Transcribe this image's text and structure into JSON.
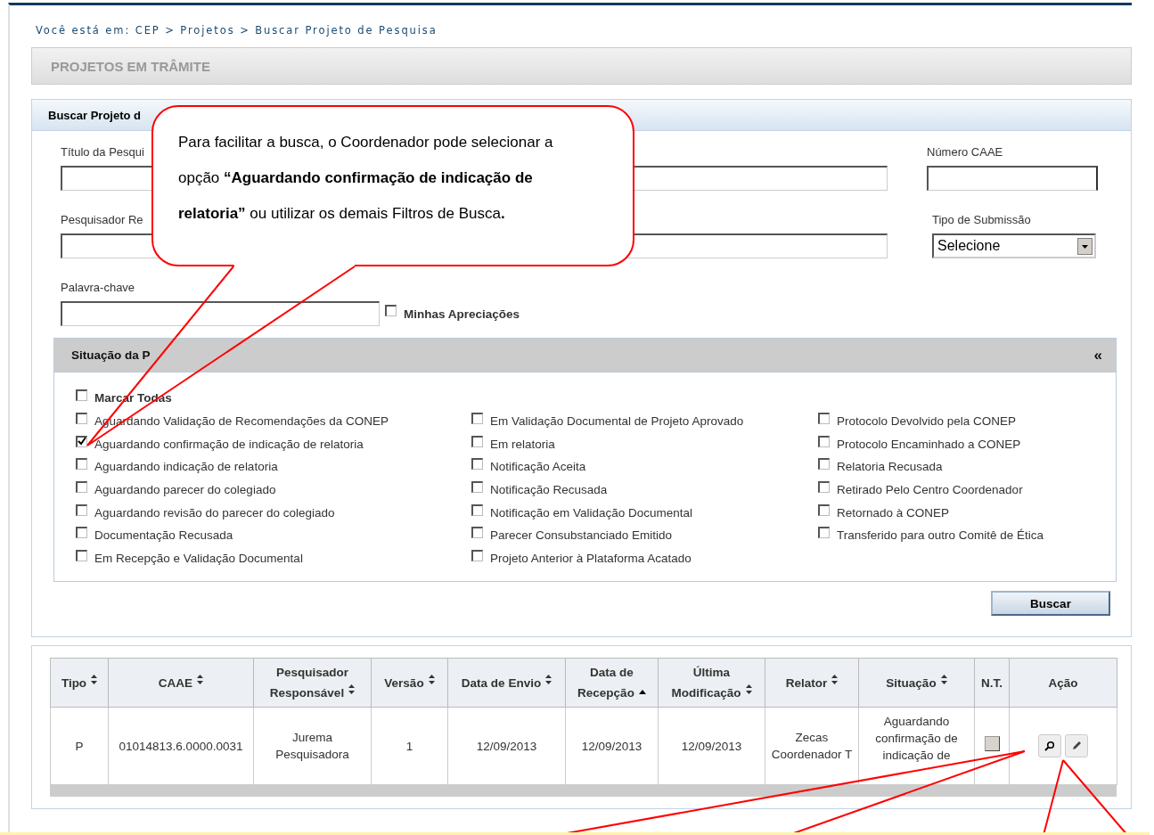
{
  "breadcrumb": "Você está em: CEP > Projetos > Buscar Projeto de Pesquisa",
  "page_title": "PROJETOS EM TRÂMITE",
  "search_panel": {
    "title": "Buscar Projeto d",
    "title_field": {
      "label": "Título da Pesqui"
    },
    "caae_field": {
      "label": "Número CAAE"
    },
    "researcher_field": {
      "label": "Pesquisador Re"
    },
    "submission_type_field": {
      "label": "Tipo de Submissão",
      "value": "Selecione"
    },
    "keyword_field": {
      "label": "Palavra-chave"
    },
    "my_reviews": {
      "label": "Minhas Apreciações",
      "checked": false
    },
    "status_filter": {
      "title": "Situação da P",
      "collapse_icon": "«",
      "select_all": {
        "label": "Marcar Todas",
        "checked": false
      },
      "columns": [
        {
          "options": [
            {
              "label": "Aguardando Validação de Recomendações da CONEP",
              "checked": false
            },
            {
              "label": "Aguardando confirmação de indicação de relatoria",
              "checked": true
            },
            {
              "label": "Aguardando indicação de relatoria",
              "checked": false
            },
            {
              "label": "Aguardando parecer do colegiado",
              "checked": false
            },
            {
              "label": "Aguardando revisão do parecer do colegiado",
              "checked": false
            },
            {
              "label": "Documentação Recusada",
              "checked": false
            },
            {
              "label": "Em Recepção e Validação Documental",
              "checked": false
            }
          ]
        },
        {
          "options": [
            {
              "label": "Em Validação Documental de Projeto Aprovado",
              "checked": false
            },
            {
              "label": "Em relatoria",
              "checked": false
            },
            {
              "label": "Notificação Aceita",
              "checked": false
            },
            {
              "label": "Notificação Recusada",
              "checked": false
            },
            {
              "label": "Notificação em Validação Documental",
              "checked": false
            },
            {
              "label": "Parecer Consubstanciado Emitido",
              "checked": false
            },
            {
              "label": "Projeto Anterior à Plataforma Acatado",
              "checked": false
            }
          ]
        },
        {
          "options": [
            {
              "label": "Protocolo Devolvido pela CONEP",
              "checked": false
            },
            {
              "label": "Protocolo Encaminhado a CONEP",
              "checked": false
            },
            {
              "label": "Relatoria Recusada",
              "checked": false
            },
            {
              "label": "Retirado Pelo Centro Coordenador",
              "checked": false
            },
            {
              "label": "Retornado à CONEP",
              "checked": false
            },
            {
              "label": "Transferido para outro Comitê de Ética",
              "checked": false
            }
          ]
        }
      ]
    },
    "search_button": "Buscar"
  },
  "table": {
    "columns": [
      {
        "label": "Tipo",
        "sortable": true,
        "sorted": false
      },
      {
        "label": "CAAE",
        "sortable": true,
        "sorted": false
      },
      {
        "label": "Pesquisador Responsável",
        "sortable": true,
        "sorted": false
      },
      {
        "label": "Versão",
        "sortable": true,
        "sorted": false
      },
      {
        "label": "Data de Envio",
        "sortable": true,
        "sorted": false
      },
      {
        "label": "Data de Recepção",
        "sortable": true,
        "sorted": true
      },
      {
        "label": "Última Modificação",
        "sortable": true,
        "sorted": false
      },
      {
        "label": "Relator",
        "sortable": true,
        "sorted": false
      },
      {
        "label": "Situação",
        "sortable": true,
        "sorted": false
      },
      {
        "label": "N.T.",
        "sortable": false,
        "sorted": false
      },
      {
        "label": "Ação",
        "sortable": false,
        "sorted": false
      }
    ],
    "rows": [
      {
        "cells": [
          "P",
          "01014813.6.0000.0031",
          "Jurema Pesquisadora",
          "1",
          "12/09/2013",
          "12/09/2013",
          "12/09/2013",
          "Zecas Coordenador T",
          "Aguardando confirmação de indicação de"
        ],
        "nt_checked": false
      }
    ]
  },
  "callout": {
    "text": "Para facilitar a busca, o Coordenador pode selecionar a opção **“Aguardando confirmação de indicação de relatoria”** ou utilizar os demais Filtros de Busca**.**"
  }
}
